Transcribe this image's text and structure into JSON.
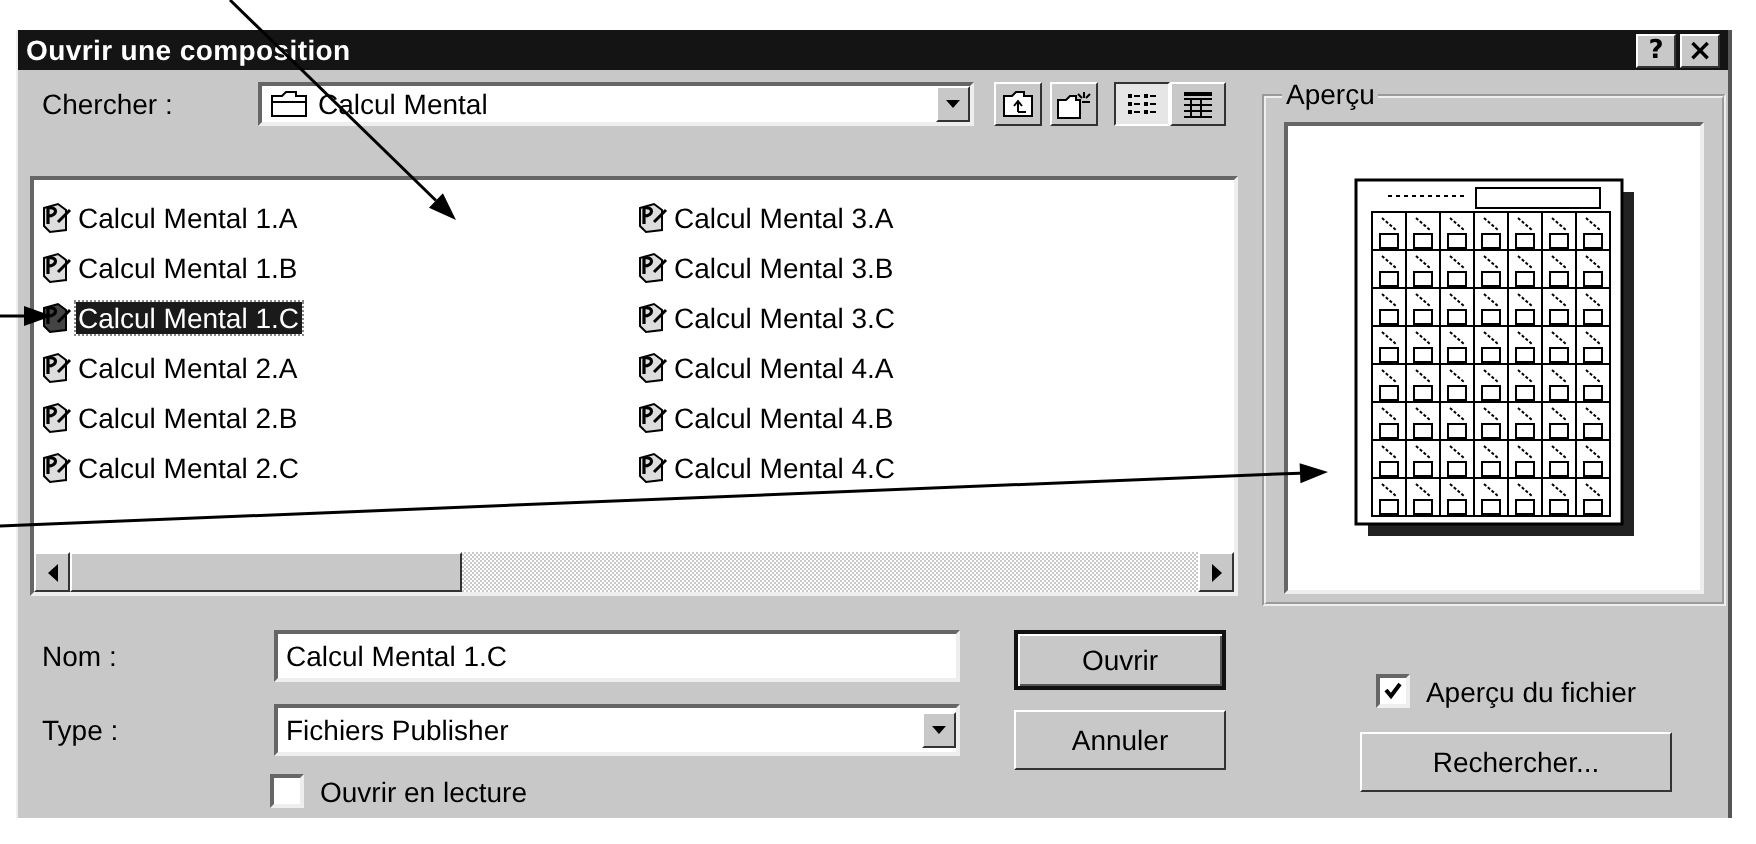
{
  "window": {
    "title": "Ouvrir une composition",
    "buttons": [
      {
        "kind": "help",
        "label": "?"
      },
      {
        "kind": "close",
        "label": "×"
      }
    ]
  },
  "look_in": {
    "label": "Chercher :",
    "value": "Calcul Mental"
  },
  "view_modes": [
    {
      "kind": "list",
      "selected": true
    },
    {
      "kind": "details",
      "selected": false
    }
  ],
  "files": [
    {
      "name": "Calcul Mental 1.A",
      "selected": false
    },
    {
      "name": "Calcul Mental 1.B",
      "selected": false
    },
    {
      "name": "Calcul Mental 1.C",
      "selected": true
    },
    {
      "name": "Calcul Mental 2.A",
      "selected": false
    },
    {
      "name": "Calcul Mental 2.B",
      "selected": false
    },
    {
      "name": "Calcul Mental 2.C",
      "selected": false
    },
    {
      "name": "Calcul Mental 3.A",
      "selected": false
    },
    {
      "name": "Calcul Mental 3.B",
      "selected": false
    },
    {
      "name": "Calcul Mental 3.C",
      "selected": false
    },
    {
      "name": "Calcul Mental 4.A",
      "selected": false
    },
    {
      "name": "Calcul Mental 4.B",
      "selected": false
    },
    {
      "name": "Calcul Mental 4.C",
      "selected": false
    }
  ],
  "name_field": {
    "label": "Nom :",
    "value": "Calcul Mental 1.C"
  },
  "type_field": {
    "label": "Type :",
    "value": "Fichiers Publisher"
  },
  "read_only": {
    "label": "Ouvrir en lecture",
    "checked": false
  },
  "buttons": [
    {
      "label": "Ouvrir",
      "default": true
    },
    {
      "label": "Annuler",
      "default": false
    }
  ],
  "preview": {
    "title": "Aperçu"
  },
  "preview_toggle": {
    "label": "Aperçu du fichier",
    "checked": true
  },
  "find_button": {
    "label": "Rechercher..."
  }
}
